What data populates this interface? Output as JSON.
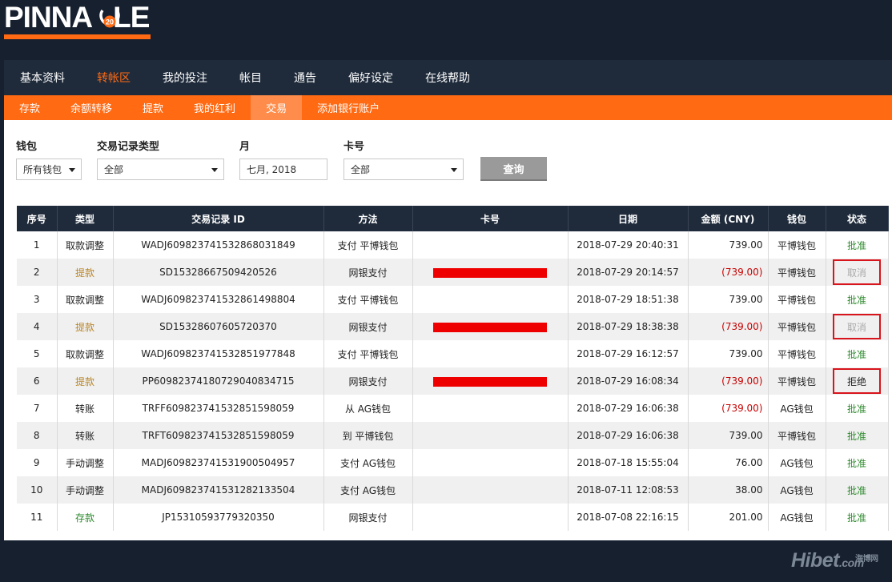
{
  "brand": {
    "logo_text_left": "PINNA",
    "logo_text_right": "LE",
    "badge": "20",
    "accent": "#ff6a13"
  },
  "topnav": [
    {
      "label": "基本资料",
      "active": false
    },
    {
      "label": "转帐区",
      "active": true
    },
    {
      "label": "我的投注",
      "active": false
    },
    {
      "label": "帐目",
      "active": false
    },
    {
      "label": "通告",
      "active": false
    },
    {
      "label": "偏好设定",
      "active": false
    },
    {
      "label": "在线帮助",
      "active": false
    }
  ],
  "subnav": [
    {
      "label": "存款",
      "active": false
    },
    {
      "label": "余额转移",
      "active": false
    },
    {
      "label": "提款",
      "active": false
    },
    {
      "label": "我的红利",
      "active": false
    },
    {
      "label": "交易",
      "active": true
    },
    {
      "label": "添加银行账户",
      "active": false
    }
  ],
  "filters": {
    "wallet": {
      "label": "钱包",
      "value": "所有钱包"
    },
    "type": {
      "label": "交易记录类型",
      "value": "全部"
    },
    "month": {
      "label": "月",
      "value": "七月, 2018"
    },
    "card": {
      "label": "卡号",
      "value": "全部"
    },
    "query_button": "查询"
  },
  "table": {
    "headers": [
      "序号",
      "类型",
      "交易记录 ID",
      "方法",
      "卡号",
      "日期",
      "金额 (CNY)",
      "钱包",
      "状态"
    ],
    "rows": [
      {
        "no": "1",
        "type": "取款调整",
        "type_kind": "adj",
        "id": "WADJ609823741532868031849",
        "method": "支付 平博钱包",
        "card": "",
        "redacted": false,
        "date": "2018-07-29 20:40:31",
        "amount": "739.00",
        "negative": false,
        "wallet": "平博钱包",
        "status": "批准",
        "status_kind": "approve",
        "boxed": false
      },
      {
        "no": "2",
        "type": "提款",
        "type_kind": "withdraw",
        "id": "SD15328667509420526",
        "method": "网银支付",
        "card": "",
        "redacted": true,
        "date": "2018-07-29 20:14:57",
        "amount": "(739.00)",
        "negative": true,
        "wallet": "平博钱包",
        "status": "取消",
        "status_kind": "cancel",
        "boxed": true
      },
      {
        "no": "3",
        "type": "取款调整",
        "type_kind": "adj",
        "id": "WADJ609823741532861498804",
        "method": "支付 平博钱包",
        "card": "",
        "redacted": false,
        "date": "2018-07-29 18:51:38",
        "amount": "739.00",
        "negative": false,
        "wallet": "平博钱包",
        "status": "批准",
        "status_kind": "approve",
        "boxed": false
      },
      {
        "no": "4",
        "type": "提款",
        "type_kind": "withdraw",
        "id": "SD15328607605720370",
        "method": "网银支付",
        "card": "",
        "redacted": true,
        "date": "2018-07-29 18:38:38",
        "amount": "(739.00)",
        "negative": true,
        "wallet": "平博钱包",
        "status": "取消",
        "status_kind": "cancel",
        "boxed": true
      },
      {
        "no": "5",
        "type": "取款调整",
        "type_kind": "adj",
        "id": "WADJ609823741532851977848",
        "method": "支付 平博钱包",
        "card": "",
        "redacted": false,
        "date": "2018-07-29 16:12:57",
        "amount": "739.00",
        "negative": false,
        "wallet": "平博钱包",
        "status": "批准",
        "status_kind": "approve",
        "boxed": false
      },
      {
        "no": "6",
        "type": "提款",
        "type_kind": "withdraw",
        "id": "PP609823741807290408347 15",
        "method": "网银支付",
        "card": "",
        "redacted": true,
        "date": "2018-07-29 16:08:34",
        "amount": "(739.00)",
        "negative": true,
        "wallet": "平博钱包",
        "status": "拒绝",
        "status_kind": "reject",
        "boxed": true
      },
      {
        "no": "7",
        "type": "转账",
        "type_kind": "adj",
        "id": "TRFF609823741532851598059",
        "method": "从 AG钱包",
        "card": "",
        "redacted": false,
        "date": "2018-07-29 16:06:38",
        "amount": "(739.00)",
        "negative": true,
        "wallet": "AG钱包",
        "status": "批准",
        "status_kind": "approve",
        "boxed": false
      },
      {
        "no": "8",
        "type": "转账",
        "type_kind": "adj",
        "id": "TRFT609823741532851598059",
        "method": "到 平博钱包",
        "card": "",
        "redacted": false,
        "date": "2018-07-29 16:06:38",
        "amount": "739.00",
        "negative": false,
        "wallet": "平博钱包",
        "status": "批准",
        "status_kind": "approve",
        "boxed": false
      },
      {
        "no": "9",
        "type": "手动调整",
        "type_kind": "adj",
        "id": "MADJ609823741531900504957",
        "method": "支付 AG钱包",
        "card": "",
        "redacted": false,
        "date": "2018-07-18 15:55:04",
        "amount": "76.00",
        "negative": false,
        "wallet": "AG钱包",
        "status": "批准",
        "status_kind": "approve",
        "boxed": false
      },
      {
        "no": "10",
        "type": "手动调整",
        "type_kind": "adj",
        "id": "MADJ609823741531282133504",
        "method": "支付 AG钱包",
        "card": "",
        "redacted": false,
        "date": "2018-07-11 12:08:53",
        "amount": "38.00",
        "negative": false,
        "wallet": "AG钱包",
        "status": "批准",
        "status_kind": "approve",
        "boxed": false
      },
      {
        "no": "11",
        "type": "存款",
        "type_kind": "deposit",
        "id": "JP15310593779320350",
        "method": "网银支付",
        "card": "",
        "redacted": false,
        "date": "2018-07-08 22:16:15",
        "amount": "201.00",
        "negative": false,
        "wallet": "AG钱包",
        "status": "批准",
        "status_kind": "approve",
        "boxed": false
      }
    ]
  },
  "watermark": {
    "main": "Hibet",
    "small": "海博网",
    "domain": ".com"
  }
}
